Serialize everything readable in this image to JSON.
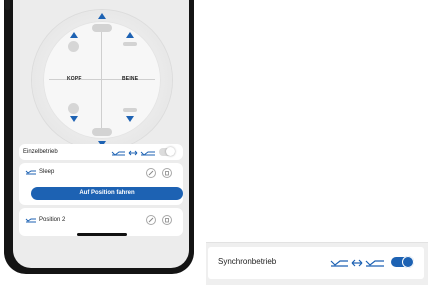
{
  "dial": {
    "head_label": "KOPF",
    "foot_label": "BEINE"
  },
  "rows": {
    "single_mode": {
      "label": "Einzelbetrieb",
      "enabled": false
    },
    "positions": [
      {
        "name": "Sleep"
      },
      {
        "name": "Position 2"
      }
    ],
    "move_button_label": "Auf Position fahren"
  },
  "detail": {
    "sync_mode": {
      "label": "Synchronbetrieb",
      "enabled": true
    }
  },
  "colors": {
    "accent": "#1d62b3",
    "screen_bg": "#ececec",
    "card_bg": "#ffffff",
    "phone_frame": "#141414"
  },
  "icons": {
    "sync": "bed-sync-arrows-icon",
    "position": "bed-position-icon",
    "edit": "pencil-icon",
    "delete": "trash-icon",
    "up": "triangle-up-icon",
    "down": "triangle-down-icon"
  }
}
